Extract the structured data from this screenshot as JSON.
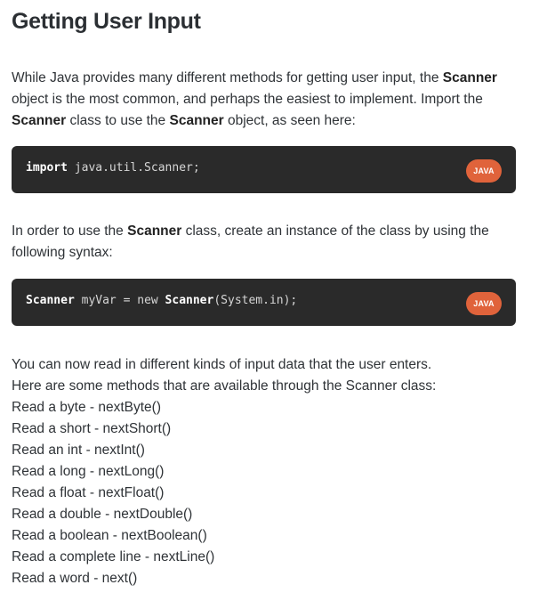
{
  "heading": "Getting User Input",
  "intro": {
    "t1": "While Java provides many different methods for getting user input, the ",
    "b1": "Scanner",
    "t2": " object is the most common, and perhaps the easiest to implement. Import the ",
    "b2": "Scanner",
    "t3": " class to use the ",
    "b3": "Scanner",
    "t4": " object, as seen here:"
  },
  "code_block_1": {
    "keyword": "import",
    "rest": " java.util.Scanner;",
    "language_badge": "JAVA"
  },
  "instance_paragraph": {
    "t1": "In order to use the ",
    "b1": "Scanner",
    "t2": " class, create an instance of the class by using the following syntax:"
  },
  "code_block_2": {
    "keyword1": "Scanner",
    "mid1": " myVar = new ",
    "keyword2": "Scanner",
    "rest": "(System.in);",
    "language_badge": "JAVA"
  },
  "methods_paragraph": {
    "line1": "You can now read in different kinds of input data that the user enters.",
    "line2": "Here are some methods that are available through the Scanner class:"
  },
  "methods": [
    "Read a byte - nextByte()",
    "Read a short - nextShort()",
    "Read an int - nextInt()",
    "Read a long - nextLong()",
    "Read a float - nextFloat()",
    "Read a double - nextDouble()",
    "Read a boolean - nextBoolean()",
    "Read a complete line - nextLine()",
    "Read a word - next()"
  ],
  "colors": {
    "code_background": "#2a2a2a",
    "badge_background": "#e0633b",
    "text": "#2f3337"
  }
}
